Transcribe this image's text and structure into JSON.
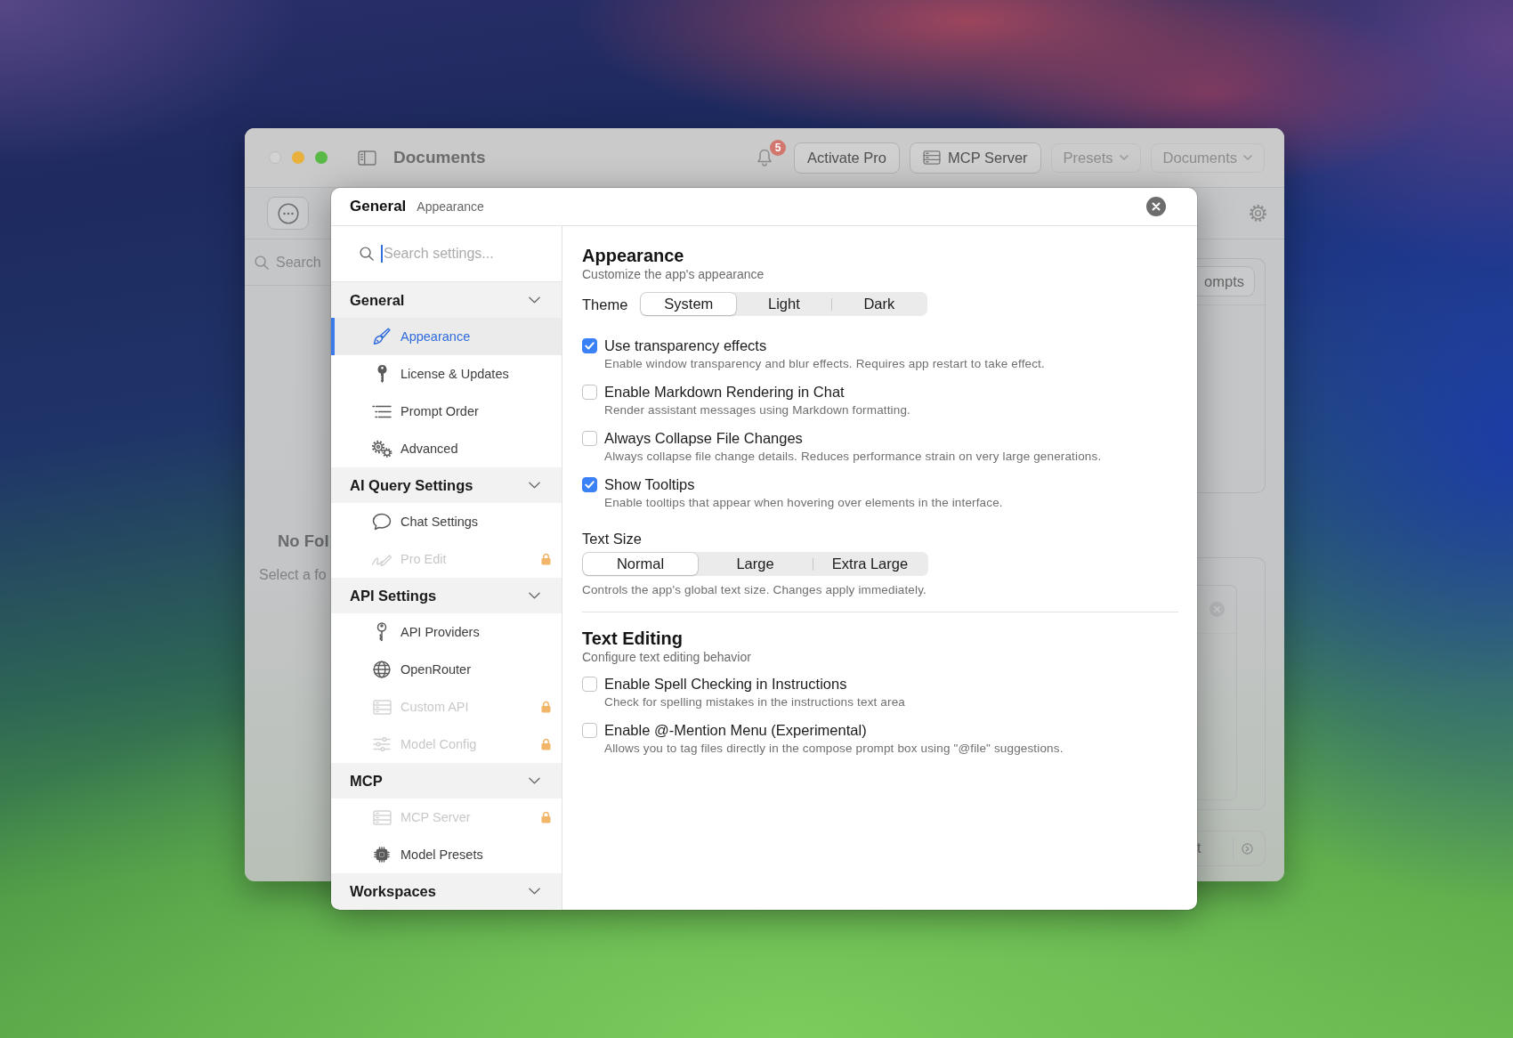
{
  "app_window": {
    "title_bar": {
      "title": "Documents",
      "notification_badge": "5",
      "buttons": [
        {
          "label": "Activate Pro",
          "kind": "plain"
        },
        {
          "label": "MCP Server",
          "kind": "icon"
        },
        {
          "label": "Presets",
          "kind": "menu"
        },
        {
          "label": "Documents",
          "kind": "menu"
        }
      ]
    },
    "left_panel": {
      "search": {
        "placeholder": "Search"
      },
      "empty_title": "No Fol",
      "empty_hint": "Select a fo"
    },
    "right_panel": {
      "prompts_button": "ompts",
      "bottom_bar": {
        "text": "t"
      }
    }
  },
  "dialog": {
    "title": "General",
    "breadcrumb": "Appearance",
    "search": {
      "placeholder": "Search settings..."
    },
    "sidebar": [
      {
        "title": "General",
        "expanded": true,
        "items": [
          {
            "label": "Appearance",
            "selected": true,
            "locked": false
          },
          {
            "label": "License & Updates",
            "selected": false,
            "locked": false
          },
          {
            "label": "Prompt Order",
            "selected": false,
            "locked": false
          },
          {
            "label": "Advanced",
            "selected": false,
            "locked": false
          }
        ]
      },
      {
        "title": "AI Query Settings",
        "expanded": true,
        "items": [
          {
            "label": "Chat Settings",
            "selected": false,
            "locked": false
          },
          {
            "label": "Pro Edit",
            "selected": false,
            "locked": true
          }
        ]
      },
      {
        "title": "API Settings",
        "expanded": true,
        "items": [
          {
            "label": "API Providers",
            "selected": false,
            "locked": false
          },
          {
            "label": "OpenRouter",
            "selected": false,
            "locked": false
          },
          {
            "label": "Custom API",
            "selected": false,
            "locked": true
          },
          {
            "label": "Model Config",
            "selected": false,
            "locked": true
          }
        ]
      },
      {
        "title": "MCP",
        "expanded": true,
        "items": [
          {
            "label": "MCP Server",
            "selected": false,
            "locked": true
          },
          {
            "label": "Model Presets",
            "selected": false,
            "locked": false
          }
        ]
      },
      {
        "title": "Workspaces",
        "expanded": true
      }
    ],
    "content": [
      {
        "title": "Appearance",
        "subtitle": "Customize the app's appearance",
        "rows": [
          {
            "kind": "segmented",
            "label": "Theme",
            "options": [
              {
                "label": "System",
                "selected": true
              },
              {
                "label": "Light",
                "selected": false
              },
              {
                "label": "Dark",
                "selected": false
              }
            ]
          },
          {
            "kind": "checkbox",
            "label": "Use transparency effects",
            "description": "Enable window transparency and blur effects. Requires app restart to take effect.",
            "checked": true
          },
          {
            "kind": "checkbox",
            "label": "Enable Markdown Rendering in Chat",
            "description": "Render assistant messages using Markdown formatting.",
            "checked": false
          },
          {
            "kind": "checkbox",
            "label": "Always Collapse File Changes",
            "description": "Always collapse file change details. Reduces performance strain on very large generations.",
            "checked": false
          },
          {
            "kind": "checkbox",
            "label": "Show Tooltips",
            "description": "Enable tooltips that appear when hovering over elements in the interface.",
            "checked": true
          },
          {
            "kind": "picker",
            "label": "Text Size",
            "options": [
              {
                "label": "Normal",
                "selected": true
              },
              {
                "label": "Large",
                "selected": false
              },
              {
                "label": "Extra Large",
                "selected": false
              }
            ],
            "description": "Controls the app's global text size. Changes apply immediately."
          }
        ]
      },
      {
        "title": "Text Editing",
        "subtitle": "Configure text editing behavior",
        "rows": [
          {
            "kind": "checkbox",
            "label": "Enable Spell Checking in Instructions",
            "description": "Check for spelling mistakes in the instructions text area",
            "checked": false
          },
          {
            "kind": "checkbox",
            "label": "Enable @-Mention Menu (Experimental)",
            "description": "Allows you to tag files directly in the compose prompt box using \"@file\" suggestions.",
            "checked": false
          }
        ]
      }
    ]
  }
}
